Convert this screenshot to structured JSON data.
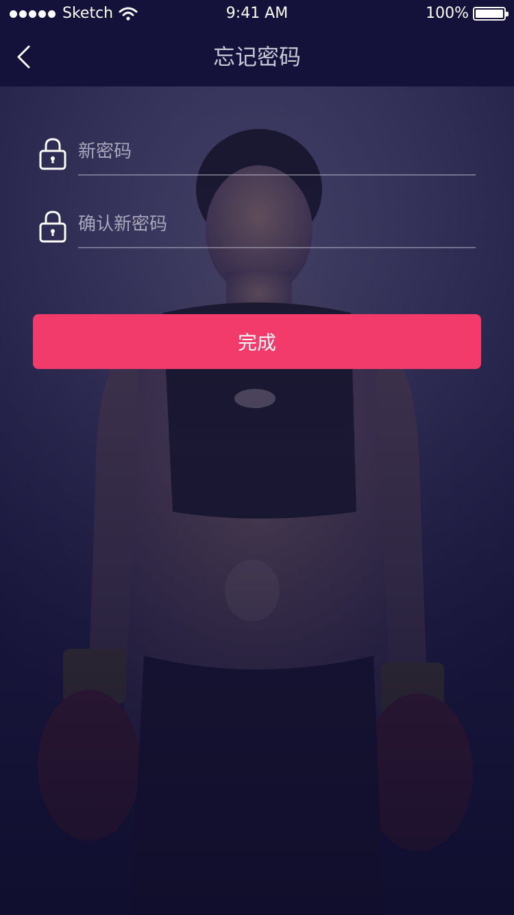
{
  "status_bar": {
    "carrier": "Sketch",
    "time": "9:41 AM",
    "battery_text": "100%",
    "battery_level": 1.0,
    "signal_icon": "signal-dots-icon",
    "wifi_icon": "wifi-icon",
    "battery_icon": "battery-icon"
  },
  "nav": {
    "title": "忘记密码",
    "back_icon": "chevron-left-icon"
  },
  "form": {
    "new_password": {
      "placeholder": "新密码",
      "value": "",
      "icon": "lock-icon"
    },
    "confirm_password": {
      "placeholder": "确认新密码",
      "value": "",
      "icon": "lock-icon"
    },
    "submit_label": "完成"
  },
  "colors": {
    "nav_background": "#14123a",
    "accent": "#f23a6b",
    "placeholder": "#a9a7bc"
  }
}
